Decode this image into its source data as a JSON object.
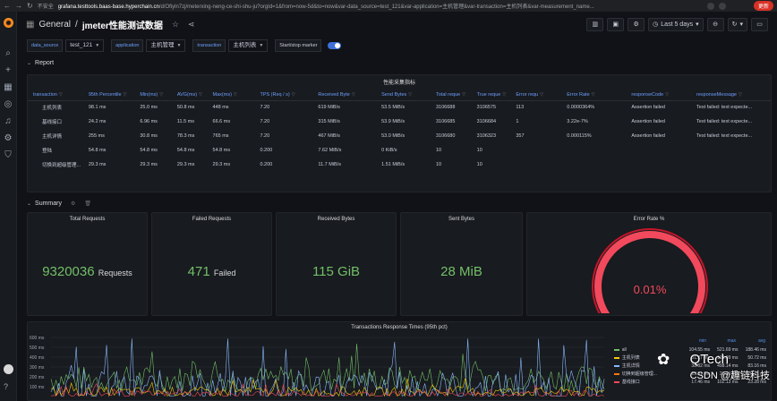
{
  "browser": {
    "not_secure": "不安全",
    "url_host": "grafana.testtools.baas-base.hyperchain.cn",
    "url_path": "/d/Ofiyln7zj/meterxing-neng-ce-shi-shu-ju?orgId=1&from=now-5d&to=now&var-data_source=test_121&var-application=主机管理&var-transaction=主机列表&var-measurement_name...",
    "update_label": "更新"
  },
  "header": {
    "folder": "General",
    "separator": "/",
    "dashboard_title": "jmeter性能测试数据",
    "time_range": "Last 5 days"
  },
  "variables": [
    {
      "label": "data_source",
      "value": "test_121"
    },
    {
      "label": "application",
      "value": "主机管理"
    },
    {
      "label": "transaction",
      "value": "主机列表"
    }
  ],
  "annotation_toggle": {
    "label": "Start/stop marker",
    "enabled": true
  },
  "rows": {
    "report": "Report",
    "summary": "Summary"
  },
  "table_panel": {
    "title": "性能采集指标",
    "columns": [
      "transaction",
      "95th Percentile",
      "Min(ms)",
      "AVG(ms)",
      "Max(ms)",
      "TPS (Req / s)",
      "Received Byte",
      "Send Bytes",
      "Total reque",
      "True reque",
      "Error requ",
      "Error Rate",
      "responseCode",
      "responseMessage"
    ],
    "rows": [
      [
        "主机列表",
        "98.1 ms",
        "25.0 ms",
        "50.8 ms",
        "448 ms",
        "7.20",
        "619 MiB/s",
        "53.5 MiB/s",
        "3106688",
        "3106575",
        "113",
        "0.0000364%",
        "Assertion failed",
        "Test failed: text expecte..."
      ],
      [
        "基线接口",
        "24.2 ms",
        "6.96 ms",
        "11.5 ms",
        "66.6 ms",
        "7.20",
        "315 MiB/s",
        "53.9 MiB/s",
        "3106685",
        "3106684",
        "1",
        "3.22e-7%",
        "Assertion failed",
        "Test failed: text expecte..."
      ],
      [
        "主机详情",
        "255 ms",
        "30.8 ms",
        "78.3 ms",
        "765 ms",
        "7.20",
        "467 MiB/s",
        "53.0 MiB/s",
        "3106680",
        "3106323",
        "357",
        "0.000115%",
        "Assertion failed",
        "Test failed: text expecte..."
      ],
      [
        "登陆",
        "54.8 ms",
        "54.8 ms",
        "54.8 ms",
        "54.8 ms",
        "0.200",
        "7.62 MiB/s",
        "0 KiB/s",
        "10",
        "10",
        "",
        "",
        "",
        ""
      ],
      [
        "切换到超级管理...",
        "29.3 ms",
        "29.3 ms",
        "29.3 ms",
        "29.3 ms",
        "0.200",
        "11.7 MiB/s",
        "1.51 MiB/s",
        "10",
        "10",
        "",
        "",
        "",
        ""
      ]
    ]
  },
  "stats": {
    "total_requests": {
      "title": "Total Requests",
      "value": "9320036",
      "unit": "Requests"
    },
    "failed_requests": {
      "title": "Failed Requests",
      "value": "471",
      "unit": "Failed"
    },
    "received_bytes": {
      "title": "Received Bytes",
      "value": "115 GiB"
    },
    "sent_bytes": {
      "title": "Sent Bytes",
      "value": "28 MiB"
    },
    "error_rate": {
      "title": "Error Rate %",
      "value": "0.01%",
      "gauge_fraction": 0.0001
    }
  },
  "graph_panel": {
    "title": "Transactions Response Times (95th pct)",
    "y_ticks": [
      "600 ms",
      "500 ms",
      "400 ms",
      "300 ms",
      "200 ms",
      "100 ms"
    ],
    "legend_headers": [
      "min",
      "max",
      "avg"
    ],
    "legend": [
      {
        "name": "all",
        "min": "104.55 ms",
        "max": "521.69 ms",
        "avg": "188.46 ms",
        "color": "#73bf69"
      },
      {
        "name": "主机列表",
        "min": "31.27 ms",
        "max": "103.99 ms",
        "avg": "50.72 ms",
        "color": "#f2cc0c"
      },
      {
        "name": "主机详情",
        "min": "38.32 ms",
        "max": "498.14 ms",
        "avg": "83.16 ms",
        "color": "#8ab8ff"
      },
      {
        "name": "切换到超级管理...",
        "min": "29.31 ms",
        "max": "29.31 ms",
        "avg": "29.31 ms",
        "color": "#ff780a"
      },
      {
        "name": "基线接口",
        "min": "17.46 ms",
        "max": "102.13 ms",
        "avg": "23.28 ms",
        "color": "#f2495c"
      }
    ]
  },
  "watermark": {
    "brand": "QTech",
    "footer": "CSDN @趣链科技"
  },
  "colors": {
    "accent": "#6e9fff",
    "stat_green": "#73bf69",
    "error_red": "#f2495c"
  }
}
